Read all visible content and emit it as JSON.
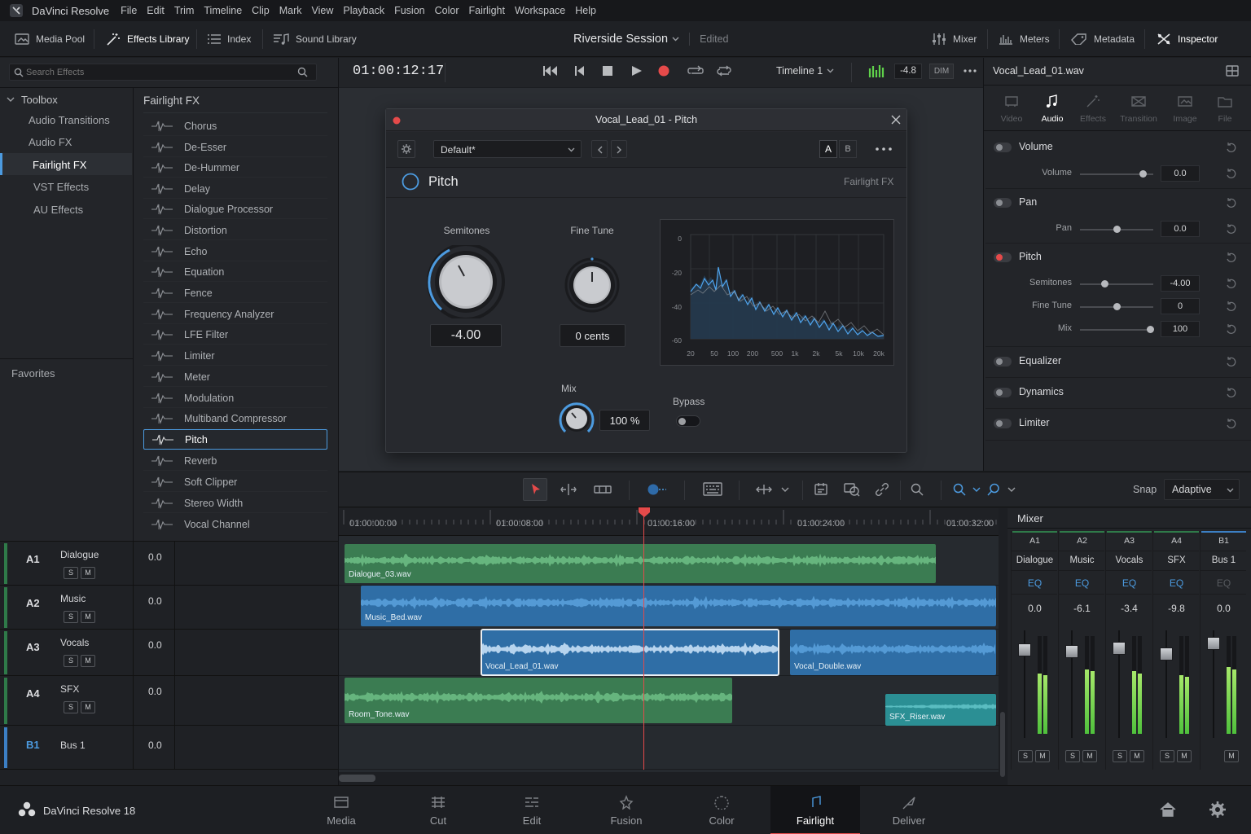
{
  "menubar": {
    "app_title": "DaVinci Resolve",
    "items": [
      "File",
      "Edit",
      "Trim",
      "Timeline",
      "Clip",
      "Mark",
      "View",
      "Playback",
      "Fusion",
      "Color",
      "Fairlight",
      "Workspace",
      "Help"
    ]
  },
  "toolbar": {
    "media_pool": "Media Pool",
    "effects_library": "Effects Library",
    "index": "Index",
    "sound_library": "Sound Library",
    "project_name": "Riverside Session",
    "project_status": "Edited",
    "mixer": "Mixer",
    "meters": "Meters",
    "metadata": "Metadata",
    "inspector": "Inspector"
  },
  "effects_panel": {
    "search_placeholder": "Search Effects",
    "toolbox_label": "Toolbox",
    "categories": [
      "Audio Transitions",
      "Audio FX",
      "Fairlight FX",
      "VST Effects",
      "AU Effects"
    ],
    "selected_category": "Fairlight FX",
    "favorites_label": "Favorites",
    "list_title": "Fairlight FX",
    "effects": [
      "Chorus",
      "De-Esser",
      "De-Hummer",
      "Delay",
      "Dialogue Processor",
      "Distortion",
      "Echo",
      "Equation",
      "Fence",
      "Frequency Analyzer",
      "LFE Filter",
      "Limiter",
      "Meter",
      "Modulation",
      "Multiband Compressor",
      "Pitch",
      "Reverb",
      "Soft Clipper",
      "Stereo Width",
      "Vocal Channel"
    ],
    "selected_effect": "Pitch"
  },
  "transport": {
    "timecode": "01:00:12:17",
    "timeline_name": "Timeline 1",
    "master_level": "-4.8",
    "dim_label": "DIM"
  },
  "plugin": {
    "window_title": "Vocal_Lead_01 - Pitch",
    "preset": "Default*",
    "ab_a": "A",
    "ab_b": "B",
    "effect_name": "Pitch",
    "category": "Fairlight FX",
    "semitones_label": "Semitones",
    "semitones_value": "-4.00",
    "finetune_label": "Fine Tune",
    "finetune_value": "0 cents",
    "mix_label": "Mix",
    "mix_value": "100 %",
    "bypass_label": "Bypass",
    "bypass_on": false,
    "spectrum": {
      "y_ticks": [
        "0",
        "-20",
        "-40",
        "-60"
      ],
      "x_ticks": [
        "20",
        "50",
        "100",
        "200",
        "500",
        "1k",
        "2k",
        "5k",
        "10k",
        "20k"
      ]
    }
  },
  "inspector": {
    "clip_name": "Vocal_Lead_01.wav",
    "tabs": [
      "Video",
      "Audio",
      "Effects",
      "Transition",
      "Image",
      "File"
    ],
    "active_tab": "Audio",
    "sections": {
      "volume": {
        "title": "Volume",
        "param": "Volume",
        "value": "0.0",
        "level": 0.85
      },
      "pan": {
        "title": "Pan",
        "param": "Pan",
        "value": "0.0",
        "level": 0.5
      },
      "pitch": {
        "title": "Pitch",
        "semitones_label": "Semitones",
        "semitones_value": "-4.00",
        "semitones_level": 0.33,
        "finetune_label": "Fine Tune",
        "finetune_value": "0",
        "finetune_level": 0.5,
        "mix_label": "Mix",
        "mix_value": "100",
        "mix_level": 0.95
      },
      "equalizer": {
        "title": "Equalizer"
      },
      "dynamics": {
        "title": "Dynamics"
      },
      "limiter": {
        "title": "Limiter"
      }
    }
  },
  "timeline_toolbar": {
    "snap_label": "Snap",
    "snap_value": "Adaptive"
  },
  "ruler": [
    "01:00:00:00",
    "01:00:08:00",
    "01:00:16:00",
    "01:00:24:00",
    "01:00:32:00"
  ],
  "tracks": [
    {
      "id": "A1",
      "name": "Dialogue",
      "level": "0.0",
      "solo": "S",
      "mute": "M"
    },
    {
      "id": "A2",
      "name": "Music",
      "level": "0.0",
      "solo": "S",
      "mute": "M"
    },
    {
      "id": "A3",
      "name": "Vocals",
      "level": "0.0",
      "solo": "S",
      "mute": "M"
    },
    {
      "id": "A4",
      "name": "SFX",
      "level": "0.0",
      "solo": "S",
      "mute": "M"
    },
    {
      "id": "B1",
      "name": "Bus 1",
      "level": "0.0"
    }
  ],
  "clips": {
    "dialogue": "Dialogue_03.wav",
    "music": "Music_Bed.wav",
    "vocal_lead": "Vocal_Lead_01.wav",
    "vocal_double": "Vocal_Double.wav",
    "room_tone": "Room_Tone.wav",
    "sfx_riser": "SFX_Riser.wav"
  },
  "mixer": {
    "title": "Mixer",
    "channels": [
      {
        "id": "A1",
        "name": "Dialogue",
        "eq": "EQ",
        "level": "0.0",
        "meter": 0.62,
        "fader": 0.82,
        "solo": "S",
        "mute": "M"
      },
      {
        "id": "A2",
        "name": "Music",
        "eq": "EQ",
        "level": "-6.1",
        "meter": 0.66,
        "fader": 0.8,
        "solo": "S",
        "mute": "M"
      },
      {
        "id": "A3",
        "name": "Vocals",
        "eq": "EQ",
        "level": "-3.4",
        "meter": 0.64,
        "fader": 0.83,
        "solo": "S",
        "mute": "M"
      },
      {
        "id": "A4",
        "name": "SFX",
        "eq": "EQ",
        "level": "-9.8",
        "meter": 0.6,
        "fader": 0.78,
        "solo": "S",
        "mute": "M"
      },
      {
        "id": "B1",
        "name": "Bus 1",
        "eq": "EQ",
        "level": "0.0",
        "meter": 0.68,
        "fader": 0.88,
        "mute": "M"
      }
    ]
  },
  "pagebar": {
    "app_version": "DaVinci Resolve 18",
    "pages": [
      "Media",
      "Cut",
      "Edit",
      "Fusion",
      "Color",
      "Fairlight",
      "Deliver"
    ],
    "active_page": "Fairlight"
  },
  "colors": {
    "accent_blue": "#4c9be0",
    "record_red": "#e54a4a",
    "clip_green": "#3b7c52",
    "clip_blue": "#2f6ea6",
    "clip_teal": "#2b8f94",
    "meter_green": "#5fd14a"
  }
}
